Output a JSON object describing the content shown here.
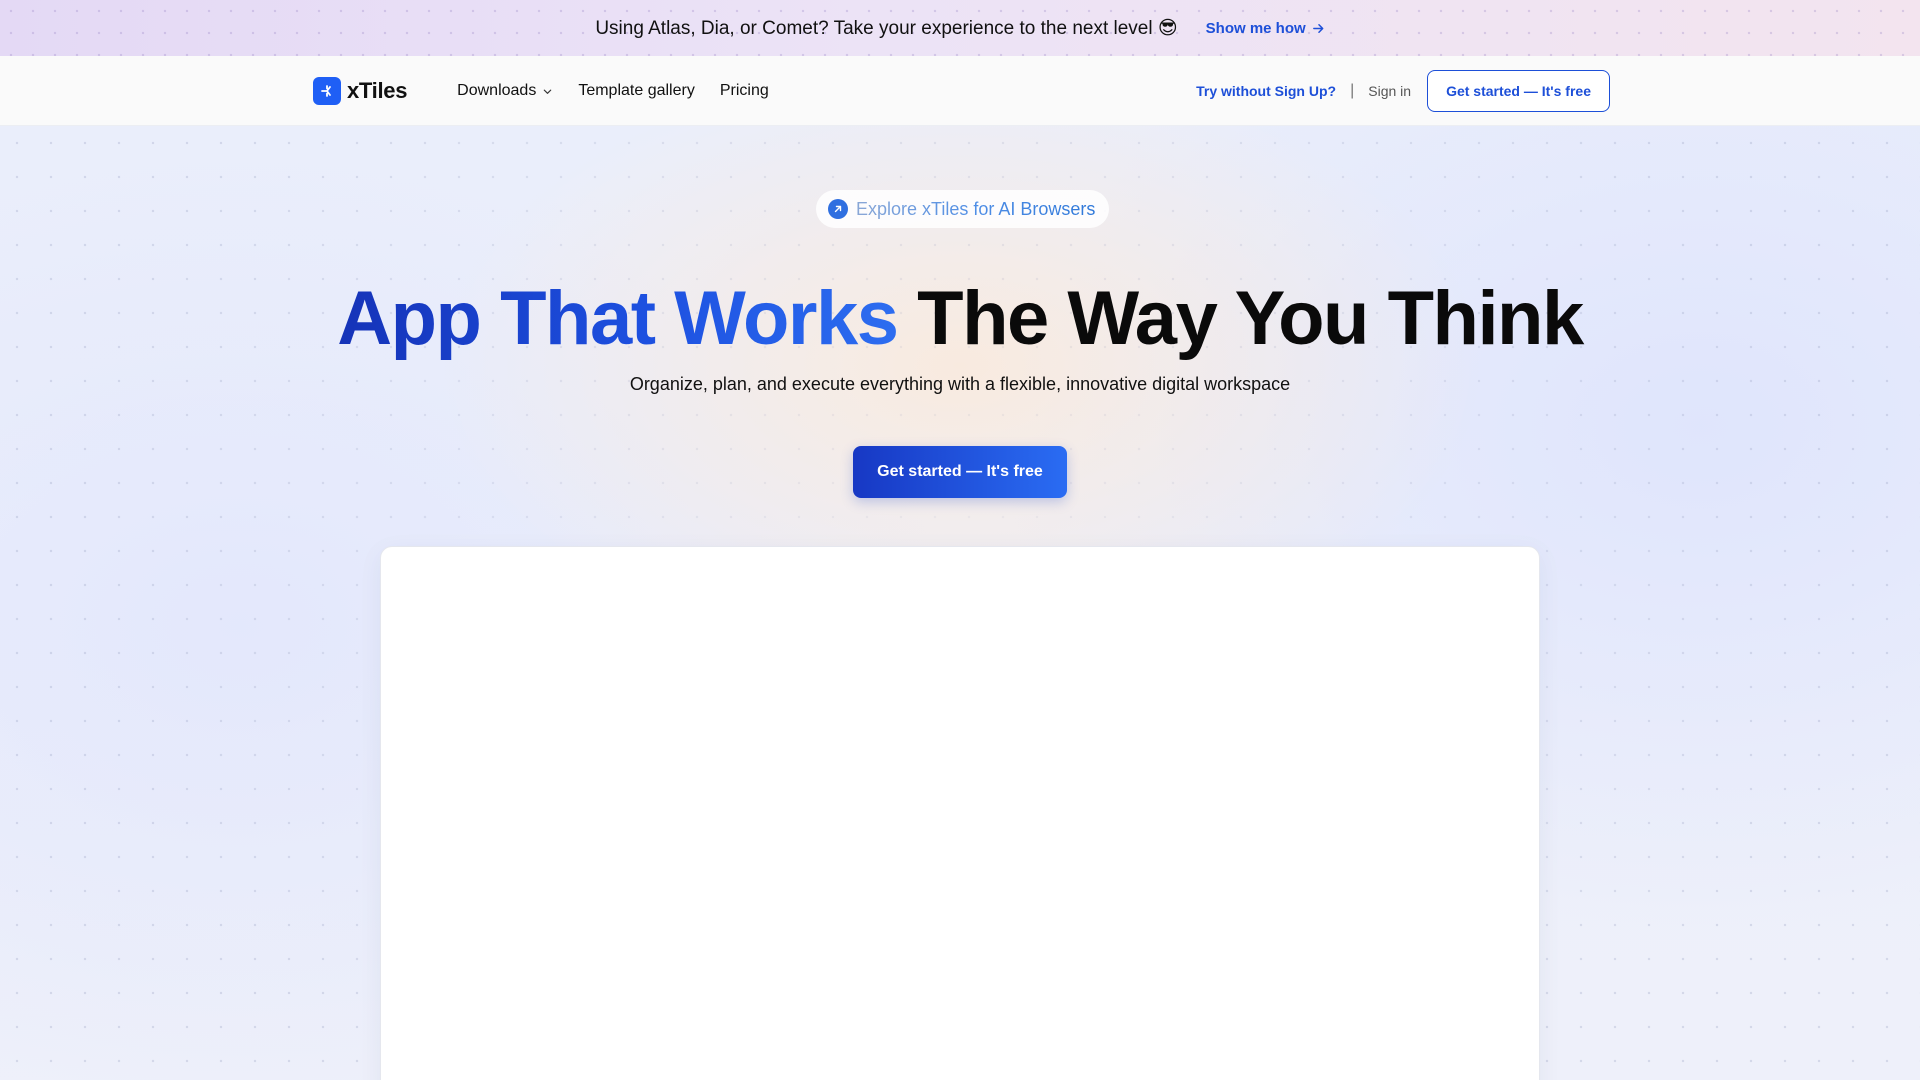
{
  "announcement": {
    "text": "Using Atlas, Dia, or Comet? Take your experience to the next level 😎",
    "link_label": "Show me how",
    "link_icon": "arrow-right-icon"
  },
  "nav": {
    "logo_text": "xTiles",
    "logo_icon": "xtiles-logo-icon",
    "links": [
      {
        "label": "Downloads",
        "has_dropdown": true
      },
      {
        "label": "Template gallery"
      },
      {
        "label": "Pricing"
      }
    ],
    "try_label": "Try without Sign Up?",
    "separator": "|",
    "signin_label": "Sign in",
    "cta_label": "Get started — It's free"
  },
  "hero": {
    "pill_label": "Explore xTiles for AI Browsers",
    "pill_icon": "arrow-up-right-icon",
    "headline_blue": "App That Works",
    "headline_dark": "The Way You Think",
    "subheadline": "Organize, plan, and execute everything with a flexible, innovative digital workspace",
    "cta_label": "Get started — It's free"
  },
  "colors": {
    "brand_blue": "#1d4fd8",
    "logo_blue": "#1f5ff5",
    "headline_dark": "#0a0a0a"
  }
}
